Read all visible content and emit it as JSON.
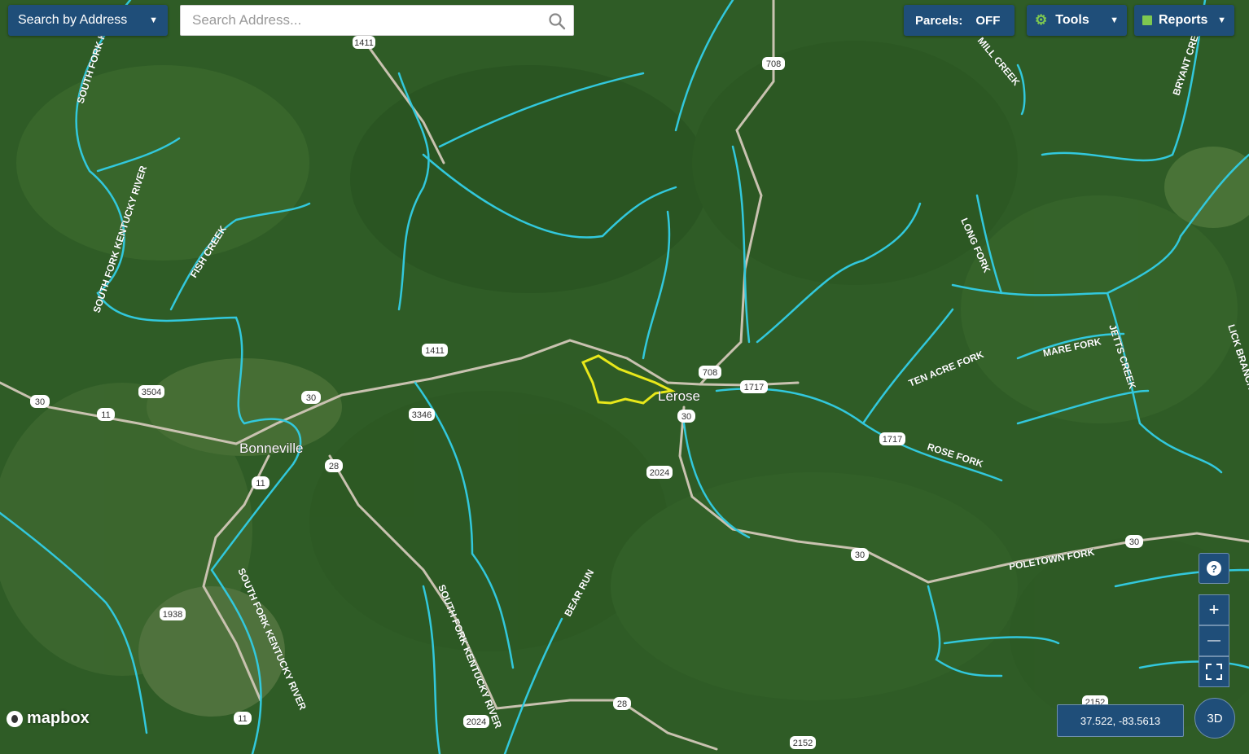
{
  "toolbar": {
    "search_by_label": "Search by Address",
    "search_placeholder": "Search Address...",
    "parcels_label": "Parcels:",
    "parcels_value": "OFF",
    "tools_label": "Tools",
    "reports_label": "Reports"
  },
  "map_labels": {
    "place_names": [
      "Bonneville",
      "Lerose"
    ],
    "streams": [
      "SOUTH FORK KE...",
      "SOUTH FORK KENTUCKY RIVER",
      "FISH CREEK",
      "MILL CREEK",
      "BRYANT CRE...",
      "LONG FORK",
      "MARE FORK",
      "JETTS CREEK",
      "LICK BRANCH",
      "TEN ACRE FORK",
      "ROSE FORK",
      "POLETOWN FORK",
      "BEAR RUN",
      "SOUTH FORK KENTUCKY RIVER",
      "SOUTH FORK KENTUCKY RIVER"
    ],
    "route_shields": [
      "1411",
      "708",
      "1411",
      "3504",
      "30",
      "11",
      "30",
      "3346",
      "708",
      "1717",
      "30",
      "28",
      "11",
      "2024",
      "1717",
      "30",
      "30",
      "1938",
      "28",
      "2024",
      "2152",
      "2152",
      "11"
    ]
  },
  "controls": {
    "help_icon": "?",
    "zoom_in_label": "+",
    "zoom_out_label": "—",
    "coordinates": "37.522, -83.5613",
    "three_d_label": "3D",
    "attribution": "mapbox"
  },
  "colors": {
    "stream": "#32c8dc",
    "road": "#c9c2b0",
    "parcel_outline": "#e8e81a",
    "control_bg": "#1f4e79"
  }
}
